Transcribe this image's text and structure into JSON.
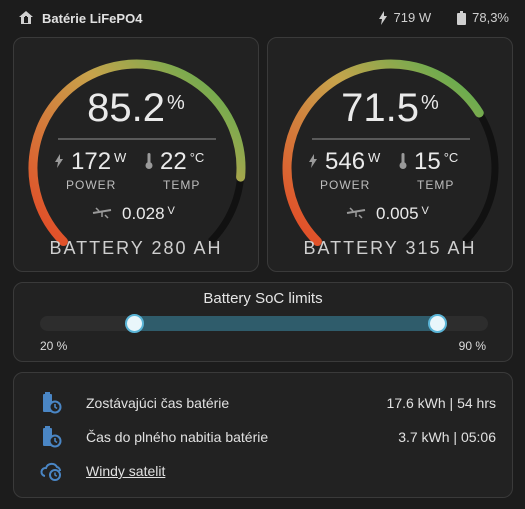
{
  "header": {
    "title": "Batérie LiFePO4",
    "power": "719 W",
    "battery_level": "78,3%",
    "icons": [
      "home-battery-icon",
      "flash-icon",
      "battery-icon"
    ]
  },
  "gauges": [
    {
      "soc_value": "85.2",
      "soc_unit": "%",
      "soc_fraction": 0.852,
      "power_value": "172",
      "power_unit": "W",
      "power_label": "POWER",
      "temp_value": "22",
      "temp_unit": "°C",
      "temp_label": "TEMP",
      "voltage_value": "0.028",
      "voltage_unit": "V",
      "name": "BATTERY 280 AH"
    },
    {
      "soc_value": "71.5",
      "soc_unit": "%",
      "soc_fraction": 0.715,
      "power_value": "546",
      "power_unit": "W",
      "power_label": "POWER",
      "temp_value": "15",
      "temp_unit": "°C",
      "temp_label": "TEMP",
      "voltage_value": "0.005",
      "voltage_unit": "V",
      "name": "BATTERY 315 AH"
    }
  ],
  "limits": {
    "title": "Battery SoC limits",
    "min_label": "20 %",
    "max_label": "90 %",
    "min_value": 20,
    "max_value": 90
  },
  "info": {
    "rows": [
      {
        "name": "Zostávajúci čas batérie",
        "value": "17.6 kWh | 54 hrs",
        "icon": "battery-clock-icon"
      },
      {
        "name": "Čas do plného nabitia batérie",
        "value": "3.7 kWh | 05:06",
        "icon": "battery-charging-clock-icon"
      },
      {
        "name": "Windy satelit",
        "value": "",
        "icon": "weather-cloud-clock-icon"
      }
    ]
  },
  "colors": {
    "gauge_low": "#e0522a",
    "gauge_mid": "#c7a34b",
    "gauge_high": "#4caf50",
    "gauge_track": "#111111",
    "accent": "#5ab4d6",
    "link": "#4fa7d8"
  }
}
